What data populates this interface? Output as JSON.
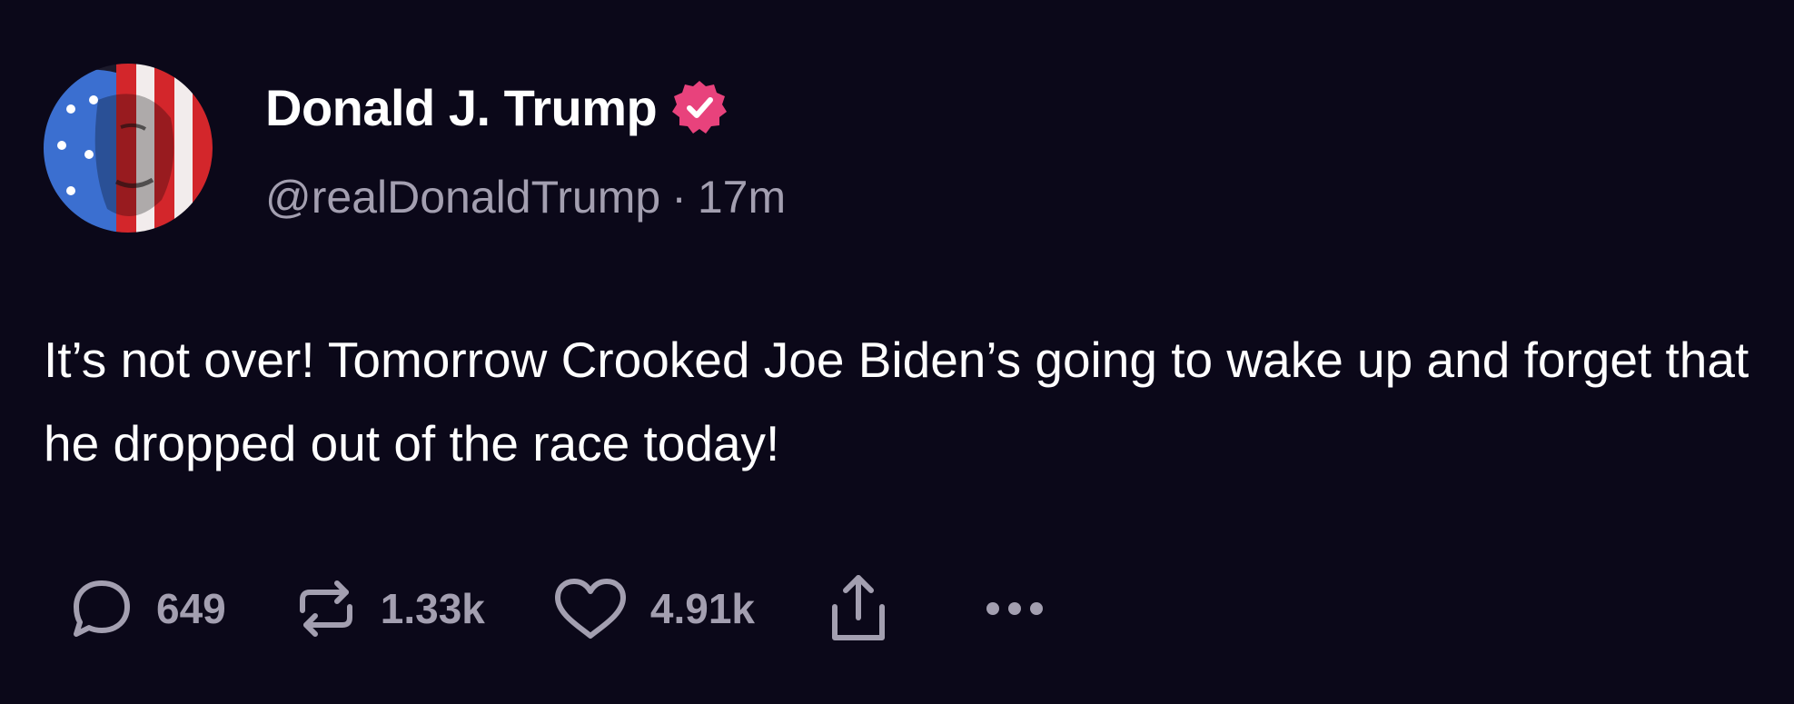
{
  "author": {
    "display_name": "Donald J. Trump",
    "handle": "@realDonaldTrump",
    "separator": "·",
    "time_ago": "17m",
    "verified": true,
    "verified_color": "#e8427c"
  },
  "post": {
    "text": "It’s not over! Tomorrow Crooked Joe Biden’s going to wake up and forget that he dropped out of the race today!"
  },
  "actions": {
    "replies": "649",
    "reposts": "1.33k",
    "likes": "4.91k",
    "icons": [
      "reply-icon",
      "repost-icon",
      "heart-icon",
      "share-icon",
      "more-icon"
    ]
  },
  "theme": {
    "background": "#0b0819",
    "text": "#ffffff",
    "muted": "#a39fb0"
  }
}
